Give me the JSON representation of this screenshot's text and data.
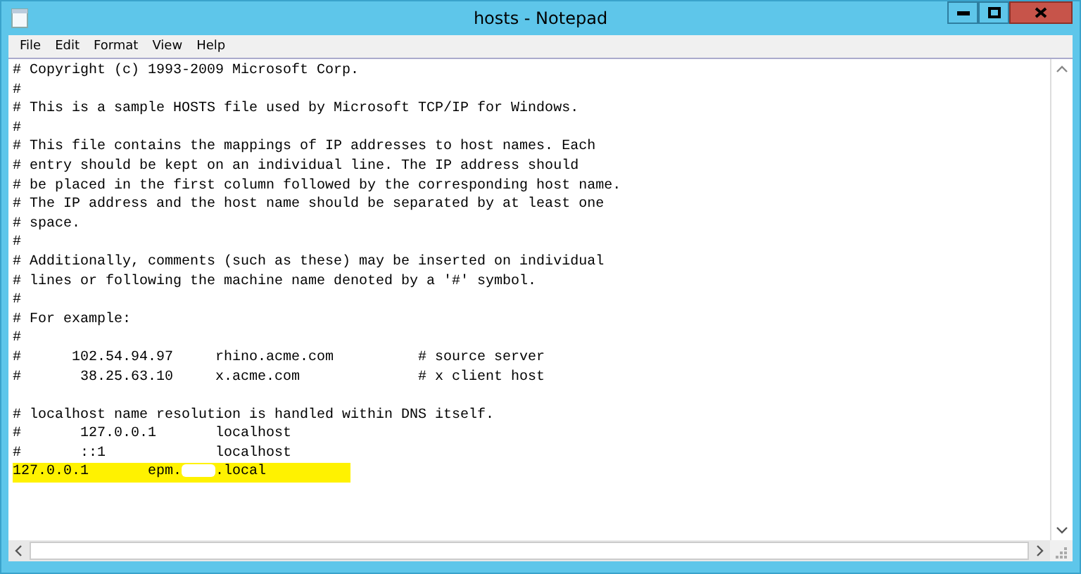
{
  "window": {
    "title": "hosts - Notepad"
  },
  "menu": [
    "File",
    "Edit",
    "Format",
    "View",
    "Help"
  ],
  "lines": [
    {
      "text": "# Copyright (c) 1993-2009 Microsoft Corp.",
      "highlighted": false
    },
    {
      "text": "#",
      "highlighted": false
    },
    {
      "text": "# This is a sample HOSTS file used by Microsoft TCP/IP for Windows.",
      "highlighted": false
    },
    {
      "text": "#",
      "highlighted": false
    },
    {
      "text": "# This file contains the mappings of IP addresses to host names. Each",
      "highlighted": false
    },
    {
      "text": "# entry should be kept on an individual line. The IP address should",
      "highlighted": false
    },
    {
      "text": "# be placed in the first column followed by the corresponding host name.",
      "highlighted": false
    },
    {
      "text": "# The IP address and the host name should be separated by at least one",
      "highlighted": false
    },
    {
      "text": "# space.",
      "highlighted": false
    },
    {
      "text": "#",
      "highlighted": false
    },
    {
      "text": "# Additionally, comments (such as these) may be inserted on individual",
      "highlighted": false
    },
    {
      "text": "# lines or following the machine name denoted by a '#' symbol.",
      "highlighted": false
    },
    {
      "text": "#",
      "highlighted": false
    },
    {
      "text": "# For example:",
      "highlighted": false
    },
    {
      "text": "#",
      "highlighted": false
    },
    {
      "text": "#      102.54.94.97     rhino.acme.com          # source server",
      "highlighted": false
    },
    {
      "text": "#       38.25.63.10     x.acme.com              # x client host",
      "highlighted": false
    },
    {
      "highlighted": false
    },
    {
      "text": "# localhost name resolution is handled within DNS itself.",
      "highlighted": false
    },
    {
      "text": "#       127.0.0.1       localhost",
      "highlighted": false
    },
    {
      "text": "#       ::1             localhost",
      "highlighted": false
    },
    {
      "text": "127.0.0.1       epm.",
      "redacted": true,
      "after": ".local",
      "highlighted": true
    }
  ]
}
